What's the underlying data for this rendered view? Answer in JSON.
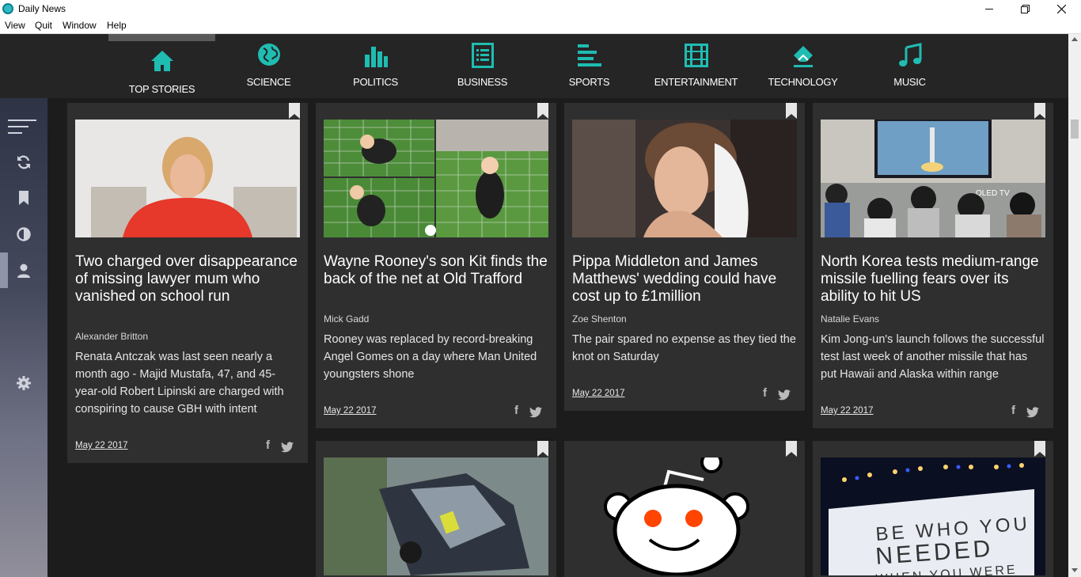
{
  "window": {
    "title": "Daily News"
  },
  "menu": [
    "View",
    "Quit",
    "Window",
    "Help"
  ],
  "colors": {
    "accent": "#1fbcb2",
    "nav_bg": "#252525",
    "card_bg": "#2f2f2f"
  },
  "categories": [
    {
      "label": "TOP STORIES",
      "icon": "home-icon"
    },
    {
      "label": "SCIENCE",
      "icon": "globe-icon"
    },
    {
      "label": "POLITICS",
      "icon": "bar-chart-icon"
    },
    {
      "label": "BUSINESS",
      "icon": "document-list-icon"
    },
    {
      "label": "SPORTS",
      "icon": "lines-icon"
    },
    {
      "label": "ENTERTAINMENT",
      "icon": "film-icon"
    },
    {
      "label": "TECHNOLOGY",
      "icon": "eraser-icon"
    },
    {
      "label": "MUSIC",
      "icon": "music-note-icon"
    }
  ],
  "sidebar": [
    "menu-icon",
    "refresh-icon",
    "bookmark-icon",
    "contrast-icon",
    "user-icon",
    "settings-icon"
  ],
  "articles": [
    {
      "headline": "Two charged over disappearance of missing lawyer mum who vanished on school run",
      "author": "Alexander Britton",
      "description": "Renata Antczak was last seen nearly a month ago - Majid Mustafa, 47, and 45-year-old Robert Lipinski are charged with conspiring to cause GBH with intent",
      "date": "May 22 2017"
    },
    {
      "headline": "Wayne Rooney's son Kit finds the back of the net at Old Trafford",
      "author": "Mick Gadd",
      "description": "Rooney was replaced by record-breaking Angel Gomes on a day where Man United youngsters shone",
      "date": "May 22 2017"
    },
    {
      "headline": "Pippa Middleton and James Matthews' wedding could have cost up to £1million",
      "author": "Zoe Shenton",
      "description": "The pair spared no expense as they tied the knot on Saturday",
      "date": "May 22 2017"
    },
    {
      "headline": "North Korea tests medium-range missile fuelling fears over its ability to hit US",
      "author": "Natalie Evans",
      "description": "Kim Jong-un's launch follows the successful test last week of another missile that has put Hawaii and Alaska within range",
      "date": "May 22 2017",
      "image_text": "QLED TV"
    },
    {
      "image": "car-crash-photo"
    },
    {
      "image": "reddit-alien-logo"
    },
    {
      "image": "sign-photo",
      "image_text": "BE WHO YOU NEEDED WHEN YOU WERE"
    }
  ]
}
